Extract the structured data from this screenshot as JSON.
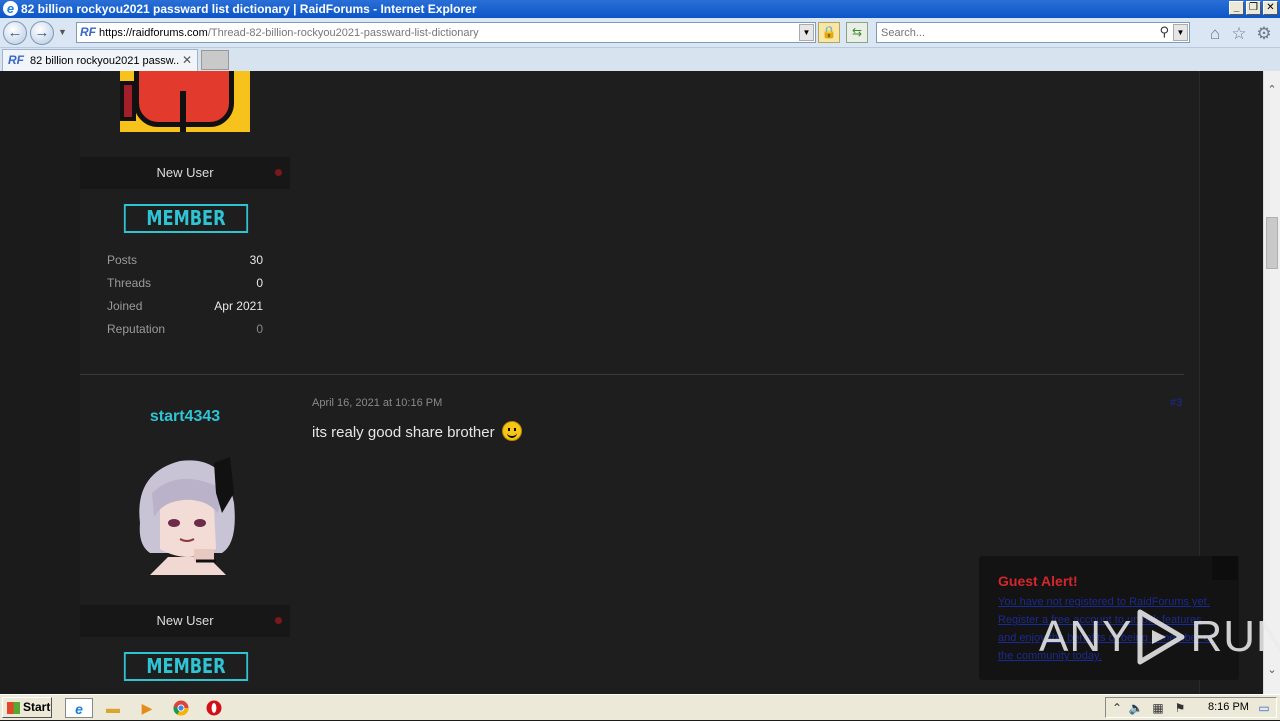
{
  "window": {
    "title": "82 billion rockyou2021 passward list dictionary | RaidForums - Internet Explorer",
    "minimize": "_",
    "restore": "❐",
    "close": "✕"
  },
  "nav": {
    "url_host": "https://raidforums.com",
    "url_path": "/Thread-82-billion-rockyou2021-passward-list-dictionary",
    "search_placeholder": "Search...",
    "favicon_text": "RF"
  },
  "tabs": [
    {
      "label": "82 billion rockyou2021 passw...",
      "favicon": "RF",
      "close": "✕"
    }
  ],
  "post1": {
    "rank": "New User",
    "badge": "MEMBER",
    "stats": [
      {
        "key": "Posts",
        "value": "30"
      },
      {
        "key": "Threads",
        "value": "0"
      },
      {
        "key": "Joined",
        "value": "Apr 2021"
      },
      {
        "key": "Reputation",
        "value": "0"
      }
    ]
  },
  "post2": {
    "username": "start4343",
    "date": "April 16, 2021 at 10:16 PM",
    "post_number": "#3",
    "body": "its realy good share brother",
    "rank": "New User",
    "badge": "MEMBER"
  },
  "guest_alert": {
    "title": "Guest Alert!",
    "body": "You have not registered to RaidForums yet. Register a free account to unlock features and enjoy the benefits of being a member of the community today."
  },
  "watermark": {
    "left": "ANY",
    "right": "RUN"
  },
  "taskbar": {
    "start_label": "Start",
    "clock": "8:16 PM"
  },
  "colors": {
    "accent_cyan": "#2ec4d4",
    "alert_red": "#d6262b",
    "page_bg": "#1b1b1b"
  },
  "icons": [
    "ie-logo-icon",
    "back-icon",
    "forward-icon",
    "lock-icon",
    "refresh-icon",
    "search-icon",
    "home-icon",
    "star-icon",
    "gear-icon",
    "smiley-icon",
    "close-icon"
  ]
}
